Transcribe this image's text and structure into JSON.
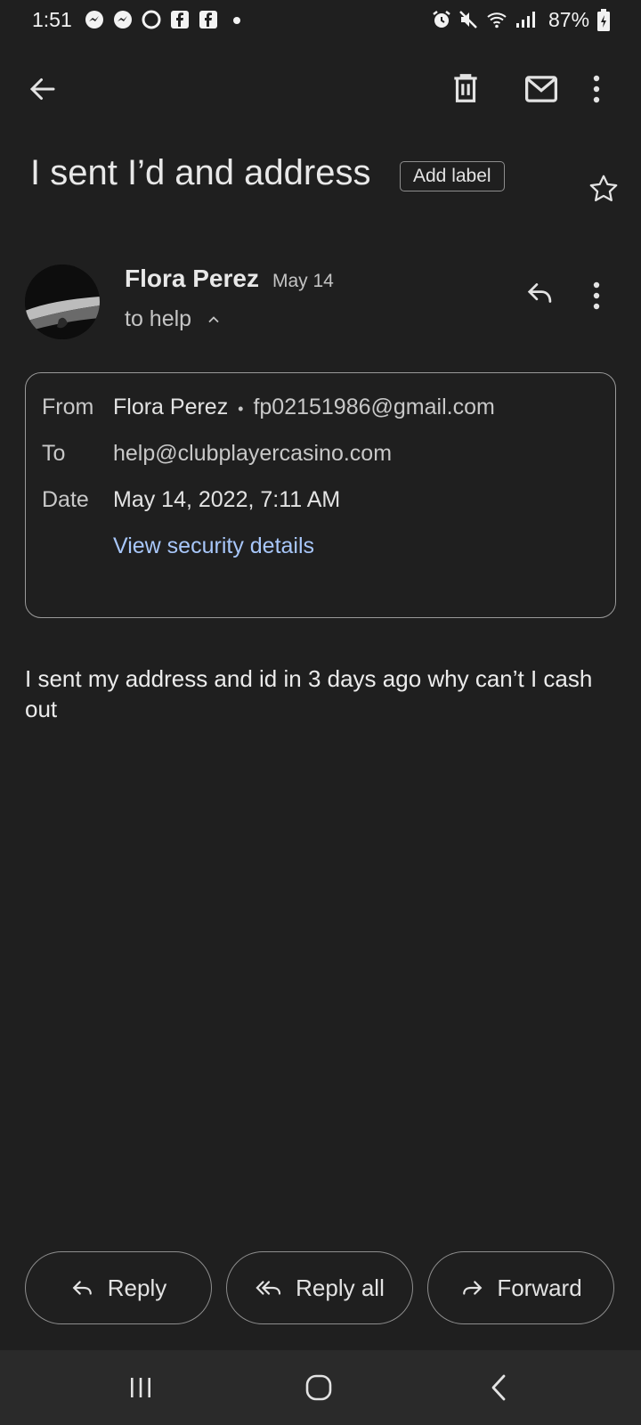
{
  "status_bar": {
    "time": "1:51",
    "battery": "87%"
  },
  "app_bar": {
    "icons": [
      "back-arrow-icon",
      "delete-icon",
      "mark-unread-icon",
      "more-vert-icon"
    ]
  },
  "email": {
    "subject": "I sent I’d and address",
    "add_label": "Add label",
    "sender_name": "Flora Perez",
    "sender_date": "May 14",
    "to_summary": "to help",
    "details": {
      "from_label": "From",
      "from_name": "Flora Perez",
      "from_sep": "•",
      "from_email": "fp02151986@gmail.com",
      "to_label": "To",
      "to_value": "help@clubplayercasino.com",
      "date_label": "Date",
      "date_value": "May 14, 2022, 7:11 AM",
      "security_link": "View security details"
    },
    "body": "I sent my address and id in 3 days ago why can’t I cash out"
  },
  "actions": {
    "reply": "Reply",
    "reply_all": "Reply all",
    "forward": "Forward"
  },
  "colors": {
    "background": "#1f1f1f",
    "link": "#a8c7fa",
    "nav_bar": "#2a2a2a"
  }
}
